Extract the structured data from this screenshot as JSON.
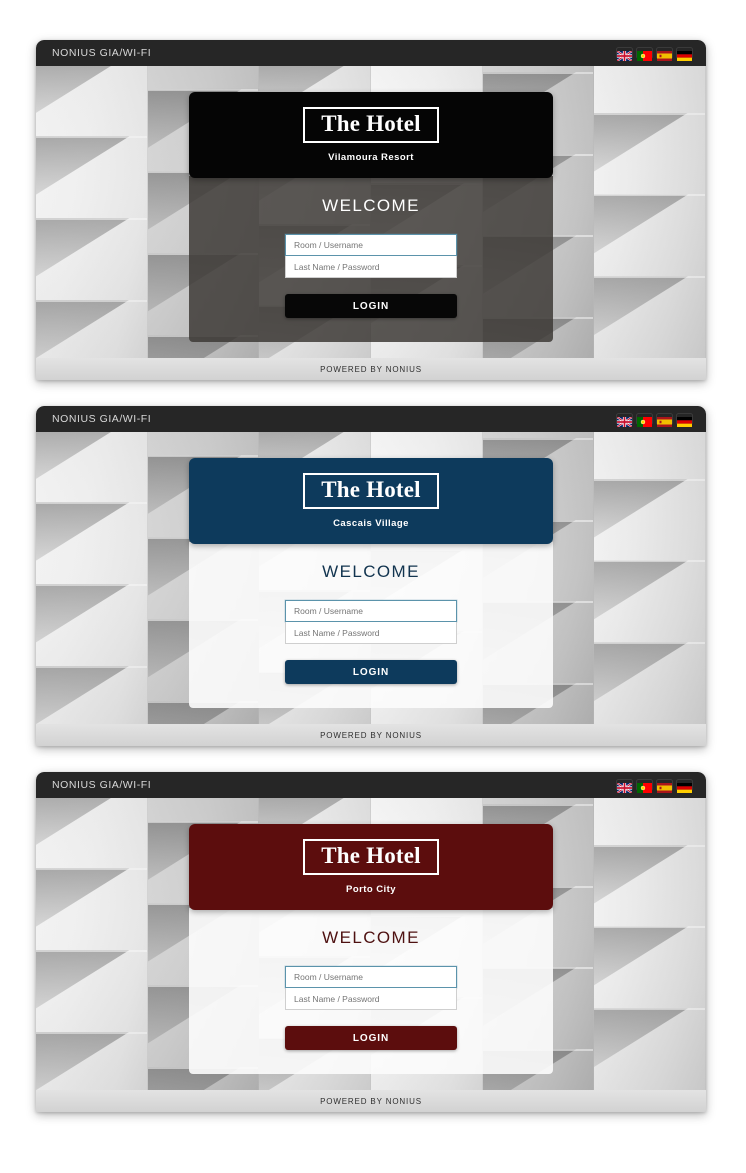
{
  "topbar": {
    "title": "NONIUS GIA/WI-FI",
    "flags": [
      {
        "name": "flag-english",
        "label": "English",
        "code": "gb"
      },
      {
        "name": "flag-portuguese",
        "label": "Portugues",
        "code": "pt"
      },
      {
        "name": "flag-spanish",
        "label": "Espanol",
        "code": "es"
      },
      {
        "name": "flag-german",
        "label": "Deutsch",
        "code": "de"
      }
    ]
  },
  "footer": {
    "text": "POWERED BY NONIUS"
  },
  "form_common": {
    "welcome": "WELCOME",
    "username_placeholder": "Room / Username",
    "password_placeholder": "Last Name / Password",
    "login_label": "LOGIN",
    "brand_title": "The Hotel"
  },
  "colors": {
    "topbar": "#262626",
    "dark_brand": "#050505",
    "dark_form": "rgba(60,56,52,0.84)",
    "navy": "#0d3a5c",
    "maroon": "#5c0d0d",
    "field_focus_border": "#5b93ab",
    "page_background": "#ffffff",
    "footer_strip": "#dcdcdc"
  },
  "panels": [
    {
      "theme": "dark",
      "brand_title": "The Hotel",
      "brand_subtitle": "Vilamoura Resort",
      "welcome": "WELCOME",
      "username_placeholder": "Room / Username",
      "password_placeholder": "Last Name / Password",
      "login_label": "LOGIN",
      "topbar_title": "NONIUS GIA/WI-FI",
      "footer_text": "POWERED BY NONIUS",
      "accent": "#050505"
    },
    {
      "theme": "navy",
      "brand_title": "The Hotel",
      "brand_subtitle": "Cascais Village",
      "welcome": "WELCOME",
      "username_placeholder": "Room / Username",
      "password_placeholder": "Last Name / Password",
      "login_label": "LOGIN",
      "topbar_title": "NONIUS GIA/WI-FI",
      "footer_text": "POWERED BY NONIUS",
      "accent": "#0d3a5c"
    },
    {
      "theme": "maroon",
      "brand_title": "The Hotel",
      "brand_subtitle": "Porto City",
      "welcome": "WELCOME",
      "username_placeholder": "Room / Username",
      "password_placeholder": "Last Name / Password",
      "login_label": "LOGIN",
      "topbar_title": "NONIUS GIA/WI-FI",
      "footer_text": "POWERED BY NONIUS",
      "accent": "#5c0d0d"
    }
  ]
}
